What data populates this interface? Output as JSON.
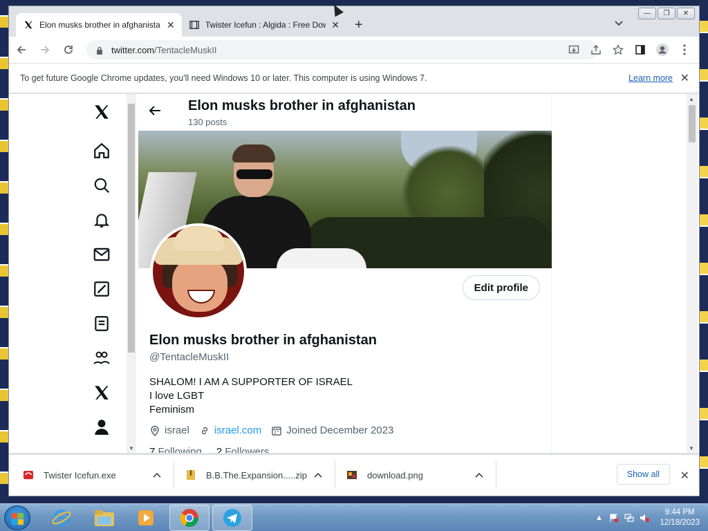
{
  "browser": {
    "tabs": [
      {
        "title": "Elon musks brother in afghanista",
        "active": true
      },
      {
        "title": "Twister Icefun : Algida : Free Dow",
        "active": false
      }
    ],
    "url_host": "twitter.com",
    "url_path": "/TentacleMuskII"
  },
  "infobar": {
    "message": "To get future Google Chrome updates, you'll need Windows 10 or later. This computer is using Windows 7.",
    "learn_more": "Learn more"
  },
  "profile": {
    "header_name": "Elon musks brother in afghanistan",
    "post_count": "130 posts",
    "display_name": "Elon musks brother in afghanistan",
    "handle": "@TentacleMuskII",
    "edit_button": "Edit profile",
    "bio_lines": [
      "SHALOM! I AM A SUPPORTER OF ISRAEL",
      "I love LGBT",
      "Feminism"
    ],
    "location": "israel",
    "website": "israel.com",
    "joined": "Joined December 2023",
    "following_count": "7",
    "following_label": "Following",
    "followers_count": "2",
    "followers_label": "Followers"
  },
  "downloads": {
    "items": [
      {
        "name": "Twister Icefun.exe",
        "icon": "exe-icon"
      },
      {
        "name": "B.B.The.Expansion.....zip",
        "icon": "zip-icon"
      },
      {
        "name": "download.png",
        "icon": "image-icon"
      }
    ],
    "show_all": "Show all"
  },
  "taskbar": {
    "time": "9:44 PM",
    "date": "12/18/2023"
  }
}
